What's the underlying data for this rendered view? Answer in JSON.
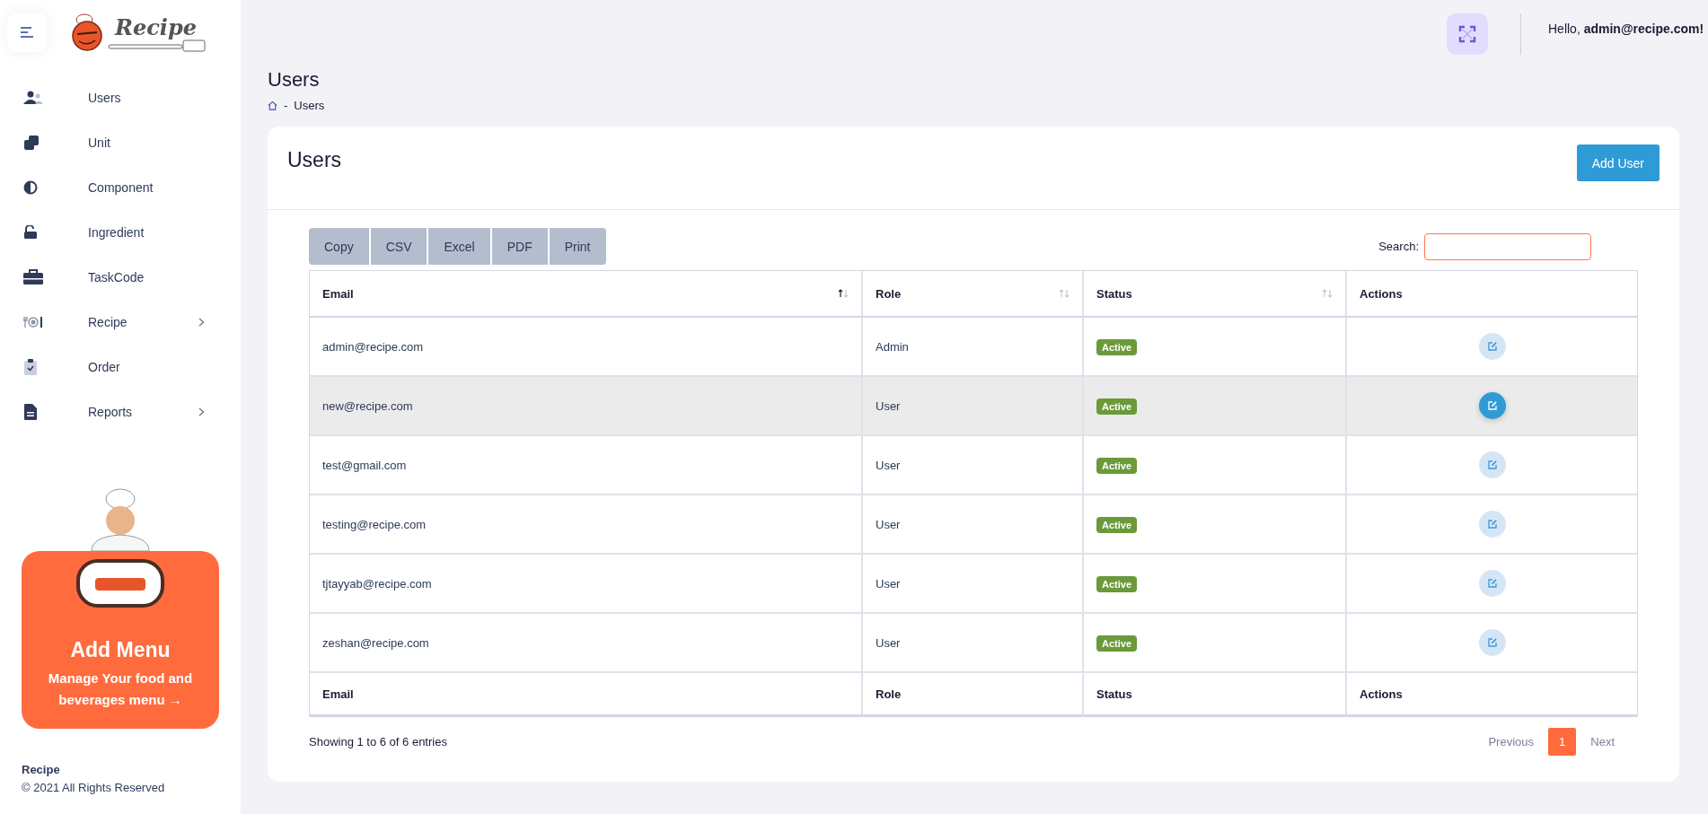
{
  "brand": {
    "name": "Recipe"
  },
  "sidebar": {
    "items": [
      {
        "label": "Users",
        "expandable": false
      },
      {
        "label": "Unit",
        "expandable": false
      },
      {
        "label": "Component",
        "expandable": false
      },
      {
        "label": "Ingredient",
        "expandable": false
      },
      {
        "label": "TaskCode",
        "expandable": false
      },
      {
        "label": "Recipe",
        "expandable": true
      },
      {
        "label": "Order",
        "expandable": false
      },
      {
        "label": "Reports",
        "expandable": true
      }
    ]
  },
  "promo": {
    "title": "Add Menu",
    "text": "Manage Your food and beverages menu",
    "arrow": "→"
  },
  "footer": {
    "name": "Recipe",
    "copyright": "© 2021 All Rights Reserved"
  },
  "header": {
    "greeting": "Hello, **admin@recipe.com!**"
  },
  "page": {
    "title": "Users",
    "breadcrumb_separator": "-",
    "breadcrumb": "Users"
  },
  "card": {
    "title": "Users",
    "add_button": "Add User"
  },
  "export_buttons": [
    "Copy",
    "CSV",
    "Excel",
    "PDF",
    "Print"
  ],
  "search": {
    "label": "Search:"
  },
  "table": {
    "columns": [
      {
        "label": "Email",
        "sortable": true,
        "sorted": true
      },
      {
        "label": "Role",
        "sortable": true,
        "sorted": false
      },
      {
        "label": "Status",
        "sortable": true,
        "sorted": false
      },
      {
        "label": "Actions",
        "sortable": false
      }
    ],
    "rows": [
      {
        "email": "admin@recipe.com",
        "role": "Admin",
        "status": "Active",
        "selected": false
      },
      {
        "email": "new@recipe.com",
        "role": "User",
        "status": "Active",
        "selected": true
      },
      {
        "email": "test@gmail.com",
        "role": "User",
        "status": "Active",
        "selected": false
      },
      {
        "email": "testing@recipe.com",
        "role": "User",
        "status": "Active",
        "selected": false
      },
      {
        "email": "tjtayyab@recipe.com",
        "role": "User",
        "status": "Active",
        "selected": false
      },
      {
        "email": "zeshan@recipe.com",
        "role": "User",
        "status": "Active",
        "selected": false
      }
    ],
    "footer_columns": [
      "Email",
      "Role",
      "Status",
      "Actions"
    ]
  },
  "info": "Showing 1 to 6 of 6 entries",
  "pagination": [
    {
      "label": "Previous",
      "selected": false,
      "disabled": true
    },
    {
      "label": "1",
      "selected": true,
      "disabled": false
    },
    {
      "label": "Next",
      "selected": false,
      "disabled": true
    }
  ]
}
